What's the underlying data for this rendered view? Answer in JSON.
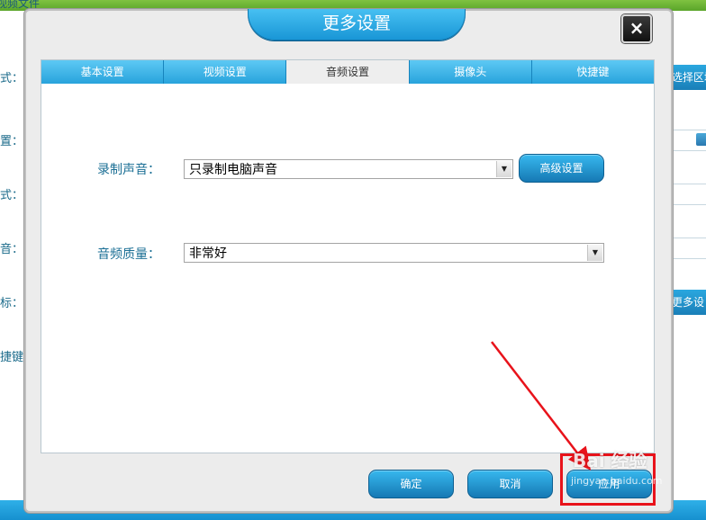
{
  "background": {
    "title_fragment": "视频文件",
    "left_labels": [
      "式：",
      "置：",
      "式：",
      "音：",
      "标：",
      "捷键"
    ],
    "right_button_top": "选择区域",
    "right_button_more": "更多设"
  },
  "dialog": {
    "title": "更多设置",
    "close_label": "×",
    "tabs": [
      {
        "label": "基本设置"
      },
      {
        "label": "视频设置"
      },
      {
        "label": "音频设置"
      },
      {
        "label": "摄像头"
      },
      {
        "label": "快捷键"
      }
    ],
    "active_tab_index": 2,
    "record_sound": {
      "label": "录制声音：",
      "value": "只录制电脑声音",
      "advanced_button": "高级设置"
    },
    "audio_quality": {
      "label": "音频质量：",
      "value": "非常好"
    },
    "buttons": {
      "ok": "确定",
      "cancel": "取消",
      "apply": "应用"
    }
  },
  "watermark": {
    "logo": "Bai 经验",
    "url": "jingyan.baidu.com"
  },
  "colors": {
    "accent_blue": "#1a96d6",
    "annotation_red": "#e8131b",
    "app_green": "#6ab536"
  }
}
